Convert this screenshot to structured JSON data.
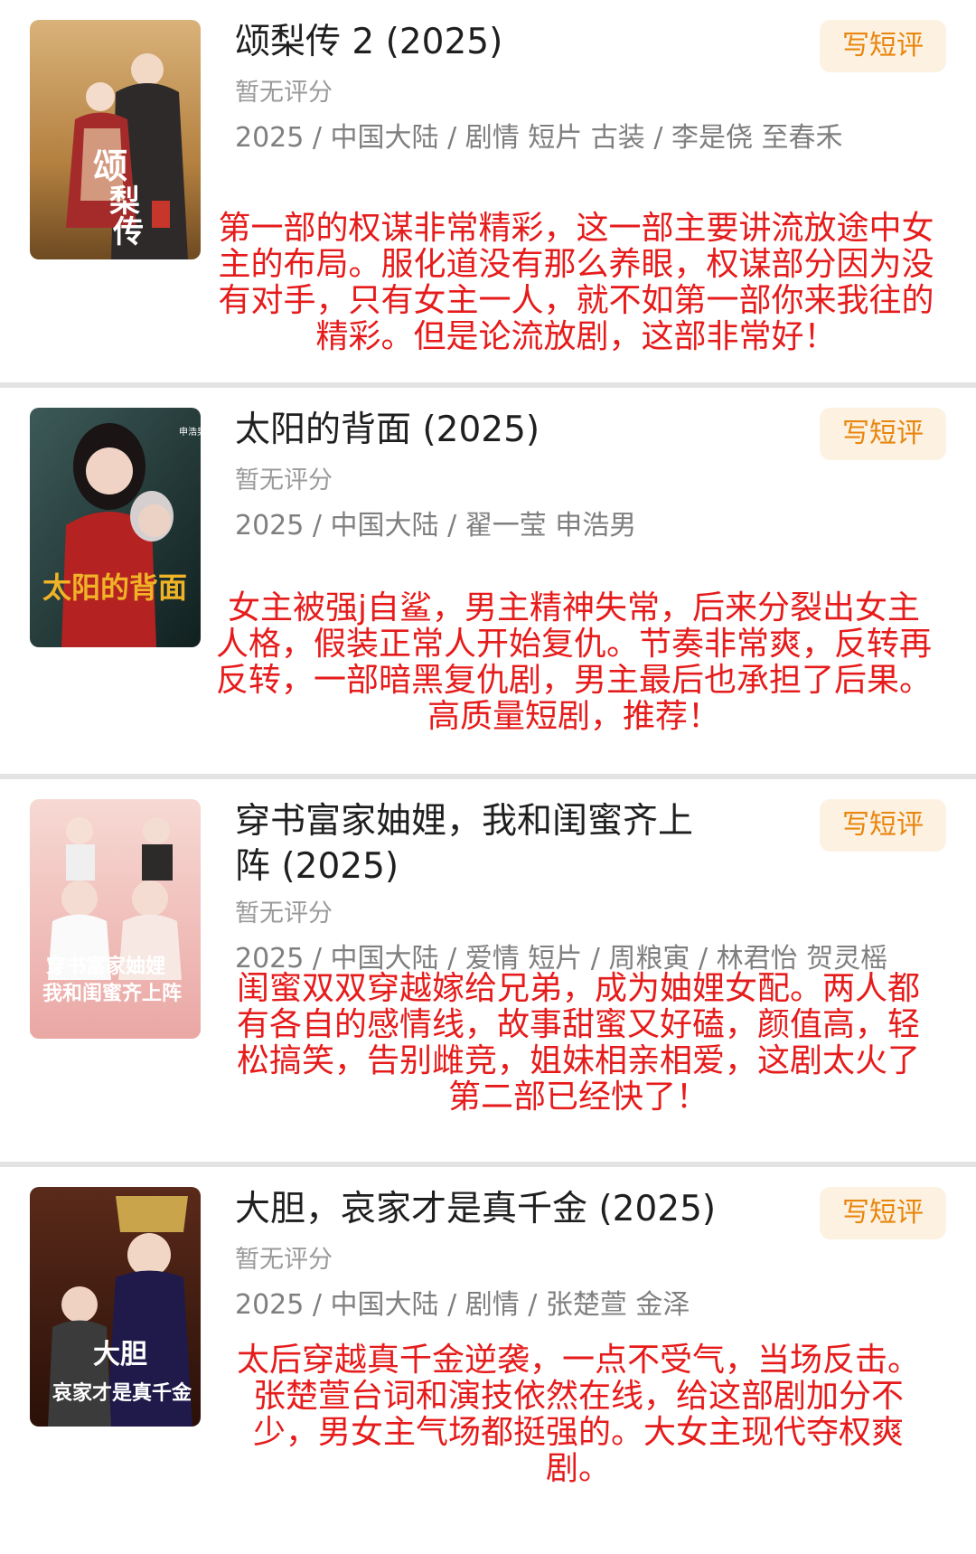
{
  "items": [
    {
      "title": "颂梨传 2",
      "year": "(2025)",
      "rating": "暂无评分",
      "meta": "2025 / 中国大陆 / 剧情 短片 古装 / 李是侥 至春禾",
      "write_label": "写短评",
      "review": "第一部的权谋非常精彩，这一部主要讲流放途中女主的布局。服化道没有那么养眼，权谋部分因为没有对手，只有女主一人，就不如第一部你来我往的精彩。但是论流放剧，这部非常好！",
      "poster_text": "颂梨传"
    },
    {
      "title": "太阳的背面",
      "year": "(2025)",
      "rating": "暂无评分",
      "meta": "2025 / 中国大陆 / 翟一莹 申浩男",
      "write_label": "写短评",
      "review": "女主被强j自鲨，男主精神失常，后来分裂出女主人格，假装正常人开始复仇。节奏非常爽，反转再反转，一部暗黑复仇剧，男主最后也承担了后果。高质量短剧，推荐！",
      "poster_text": "太阳的背面"
    },
    {
      "title": "穿书富家妯娌，我和闺蜜齐上阵",
      "year": "(2025)",
      "rating": "暂无评分",
      "meta": "2025 / 中国大陆 / 爱情 短片 / 周粮寅 / 林君怡 贺灵榣",
      "write_label": "写短评",
      "review": "闺蜜双双穿越嫁给兄弟，成为妯娌女配。两人都有各自的感情线，故事甜蜜又好磕，颜值高，轻松搞笑，告别雌竞，姐妹相亲相爱，这剧太火了第二部已经快了！",
      "poster_text": "穿书富家妯娌 我和闺蜜齐上阵"
    },
    {
      "title": "大胆，哀家才是真千金",
      "year": "(2025)",
      "rating": "暂无评分",
      "meta": "2025 / 中国大陆 / 剧情 / 张楚萱 金泽",
      "write_label": "写短评",
      "review": "太后穿越真千金逆袭，一点不受气，当场反击。张楚萱台词和演技依然在线，给这部剧加分不少，男女主气场都挺强的。大女主现代夺权爽剧。",
      "poster_text": "大胆 哀家才是真千金"
    }
  ],
  "colors": {
    "review_red": "#e61b1b",
    "button_bg": "#fdf1e1",
    "button_text": "#e8860e"
  }
}
